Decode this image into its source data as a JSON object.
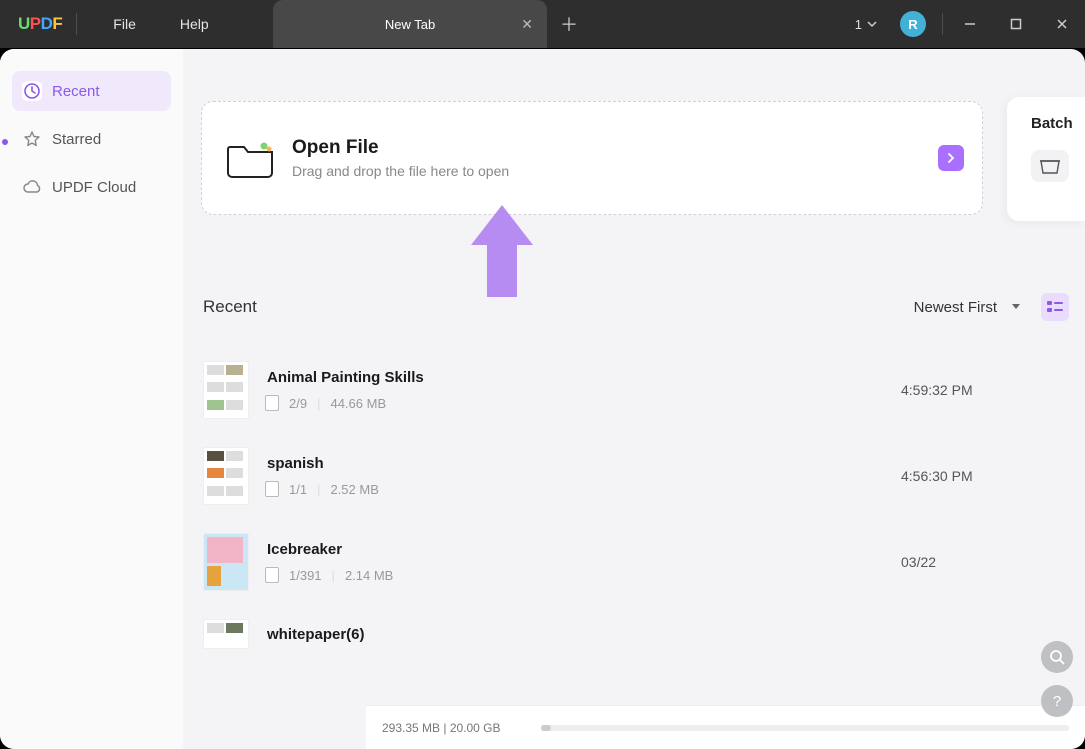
{
  "titlebar": {
    "logo": "UPDF",
    "menu": {
      "file": "File",
      "help": "Help"
    },
    "tab": {
      "label": "New Tab"
    },
    "notification_count": "1",
    "avatar_initial": "R"
  },
  "sidebar": {
    "items": [
      {
        "label": "Recent",
        "icon": "clock-icon",
        "active": true
      },
      {
        "label": "Starred",
        "icon": "star-icon",
        "active": false
      },
      {
        "label": "UPDF Cloud",
        "icon": "cloud-icon",
        "active": false
      }
    ]
  },
  "openfile": {
    "title": "Open File",
    "subtitle": "Drag and drop the file here to open"
  },
  "batch": {
    "label": "Batch"
  },
  "recent": {
    "heading": "Recent",
    "sort_label": "Newest First",
    "files": [
      {
        "name": "Animal Painting Skills",
        "pages": "2/9",
        "size": "44.66 MB",
        "time": "4:59:32 PM"
      },
      {
        "name": "spanish",
        "pages": "1/1",
        "size": "2.52 MB",
        "time": "4:56:30 PM"
      },
      {
        "name": "Icebreaker",
        "pages": "1/391",
        "size": "2.14 MB",
        "time": "03/22"
      },
      {
        "name": "whitepaper(6)",
        "pages": "",
        "size": "",
        "time": ""
      }
    ]
  },
  "status": {
    "storage": "293.35 MB | 20.00 GB"
  }
}
